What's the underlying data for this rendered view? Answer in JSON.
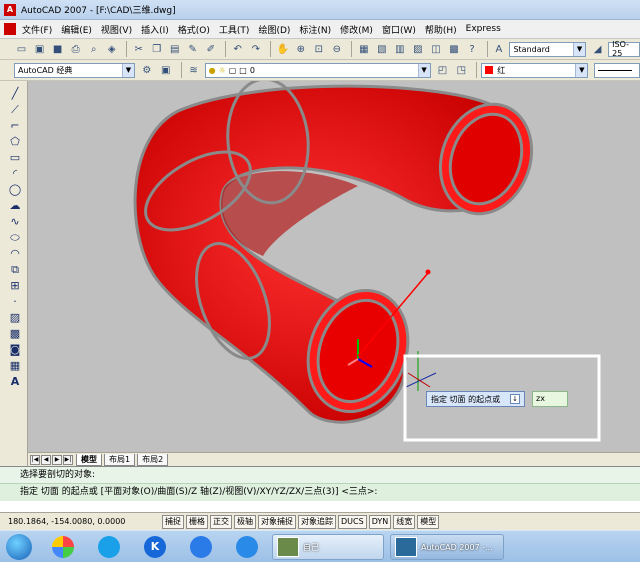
{
  "window": {
    "title": "AutoCAD 2007 - [F:\\CAD\\三维.dwg]"
  },
  "menu": [
    "文件(F)",
    "编辑(E)",
    "视图(V)",
    "插入(I)",
    "格式(O)",
    "工具(T)",
    "绘图(D)",
    "标注(N)",
    "修改(M)",
    "窗口(W)",
    "帮助(H)",
    "Express"
  ],
  "toolbar1": {
    "text_style": "Standard",
    "dim_style": "ISO-25"
  },
  "toolbar2": {
    "workspace": "AutoCAD 经典",
    "layer": "0",
    "color": "红"
  },
  "left_tools": [
    "line-icon",
    "xline-icon",
    "polyline-icon",
    "polygon-icon",
    "rectangle-icon",
    "arc-icon",
    "circle-icon",
    "revcloud-icon",
    "spline-icon",
    "ellipse-icon",
    "ellipse-arc-icon",
    "insert-block-icon",
    "make-block-icon",
    "point-icon",
    "hatch-icon",
    "gradient-icon",
    "region-icon",
    "table-icon",
    "mtext-icon"
  ],
  "left_tools_text": "A",
  "tooltip": {
    "prompt": "指定 切面 的起点或",
    "input": "zx",
    "dropdown_glyph": "↓"
  },
  "layout_tabs": [
    "模型",
    "布局1",
    "布局2"
  ],
  "command": {
    "line1": "选择要剖切的对象:",
    "line2": "指定 切面 的起点或 [平面对象(O)/曲面(S)/Z 轴(Z)/视图(V)/XY/YZ/ZX/三点(3)] <三点>:"
  },
  "status": {
    "coords": "180.1864,  -154.0080, 0.0000",
    "buttons": [
      "捕捉",
      "栅格",
      "正交",
      "极轴",
      "对象捕捉",
      "对象追踪",
      "DUCS",
      "DYN",
      "线宽",
      "模型"
    ]
  },
  "taskbar": {
    "items": [
      {
        "label": "自己"
      },
      {
        "label": "AutoCAD 2007 -..."
      }
    ]
  },
  "colors": {
    "solid": "#ff0000",
    "edges": "#8a8a8a",
    "viewport": "#c0c0c0",
    "highlight": "#ffffff"
  }
}
